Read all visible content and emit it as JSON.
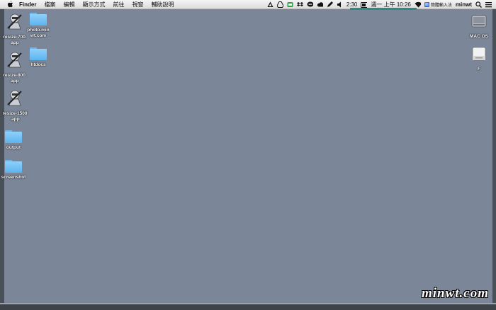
{
  "menubar": {
    "app_name": "Finder",
    "items": [
      "檔案",
      "編輯",
      "顯示方式",
      "前往",
      "視窗",
      "輔助說明"
    ],
    "clock": "2:30",
    "weekday": "週一",
    "time": "上午 10:26",
    "ime_label": "簡體輸入法",
    "ime_char": "簡",
    "user": "minwt"
  },
  "left_icons": [
    {
      "label": "resize-700.\napp",
      "line1": "resize-700.",
      "line2": "app"
    },
    {
      "label": "photo.minwt.com",
      "line1": "photo.min",
      "line2": "wt.com"
    },
    {
      "label": "htdocs"
    },
    {
      "label": "resize-800.app",
      "line1": "resize-800.",
      "line2": "app"
    },
    {
      "label": "resize-1500.app",
      "line1": "resize-1500",
      "line2": ".app"
    },
    {
      "label": "output"
    },
    {
      "label": "screenshot"
    }
  ],
  "right_icons": {
    "drive1": "MAC OS",
    "drive2": "F"
  },
  "watermark": "minwt.com"
}
